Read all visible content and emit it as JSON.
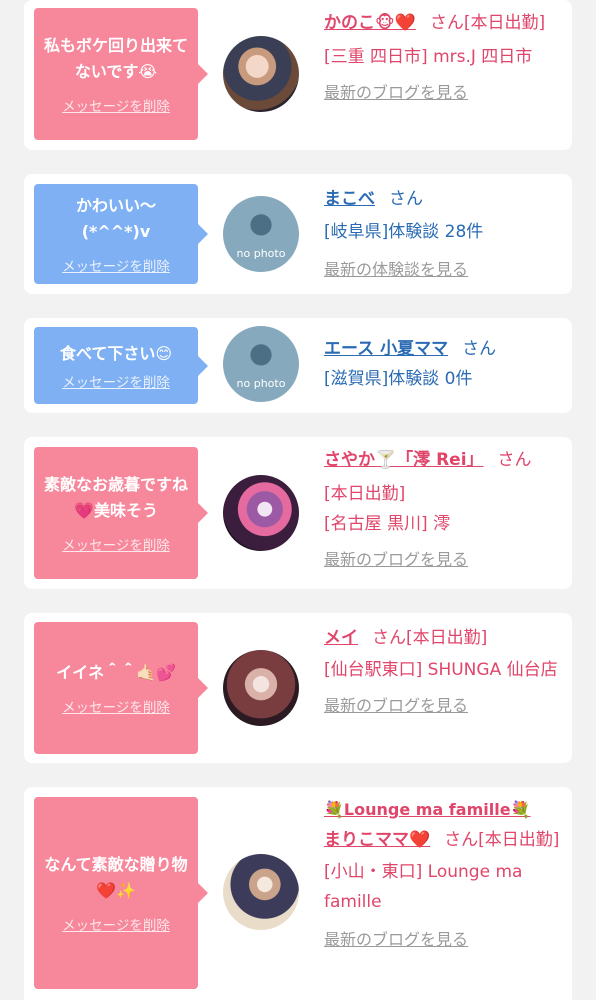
{
  "messages": [
    {
      "message": "私もボケ回り出来てないです😭",
      "delete_label": "メッセージを削除",
      "name": "かのこ🐵❤️",
      "honorific": "さん",
      "detail_1": "[本日出勤]",
      "detail_2": "[三重 四日市] mrs.J 四日市",
      "link": "最新のブログを見る"
    },
    {
      "message": "かわいい〜(*^^*)v",
      "delete_label": "メッセージを削除",
      "name": "まこべ",
      "honorific": "さん",
      "detail_1": "[岐阜県]体験談 28件",
      "avatar_text": "no photo",
      "link": "最新の体験談を見る"
    },
    {
      "message": "食べて下さい😊",
      "delete_label": "メッセージを削除",
      "name": "エース 小夏ママ",
      "honorific": "さん",
      "detail_1": "[滋賀県]体験談 0件",
      "avatar_text": "no photo"
    },
    {
      "message": "素敵なお歳暮ですね💗美味そう",
      "delete_label": "メッセージを削除",
      "name": "さやか🍸「澪 Rei」",
      "honorific": "さん",
      "detail_1": "[本日出勤]",
      "detail_2": "[名古屋 黒川] 澪",
      "link": "最新のブログを見る"
    },
    {
      "message": "イイネ＾＾🤙🏻💕",
      "delete_label": "メッセージを削除",
      "name": "メイ",
      "honorific": "さん",
      "detail_1": "[本日出勤]",
      "detail_2": "[仙台駅東口] SHUNGA 仙台店",
      "link": "最新のブログを見る"
    },
    {
      "message": "なんて素敵な贈り物❤️✨",
      "delete_label": "メッセージを削除",
      "name_prefix": "💐Lounge ma famille💐",
      "name": "まりこママ❤️",
      "honorific": "さん",
      "detail_1": "[本日出勤]",
      "detail_2": "[小山・東口] Lounge ma famille",
      "link": "最新のブログを見る"
    }
  ]
}
